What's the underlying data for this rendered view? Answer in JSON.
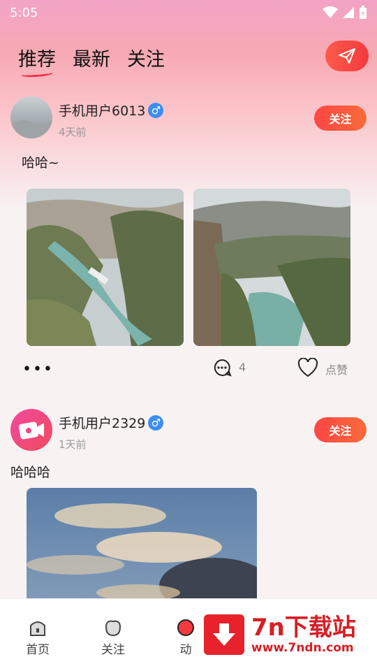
{
  "status_bar": {
    "time": "5:05"
  },
  "header": {
    "tabs": [
      {
        "label": "推荐",
        "active": true
      },
      {
        "label": "最新",
        "active": false
      },
      {
        "label": "关注",
        "active": false
      }
    ]
  },
  "posts": [
    {
      "username": "手机用户6013",
      "gender_symbol": "♂",
      "time": "4天前",
      "follow_label": "关注",
      "text": "哈哈~",
      "comment_count": "4",
      "like_label": "点赞",
      "more_label": "•••"
    },
    {
      "username": "手机用户2329",
      "gender_symbol": "♂",
      "time": "1天前",
      "follow_label": "关注",
      "text": "哈哈哈"
    }
  ],
  "bottom_nav": {
    "items": [
      {
        "label": "首页"
      },
      {
        "label": "关注"
      },
      {
        "label": "动"
      }
    ]
  },
  "watermark": {
    "title": "7n下载站",
    "url": "www.7ndn.com"
  },
  "colors": {
    "accent": "#f43a3f",
    "follow_gradient_start": "#ff4545",
    "gender_blue": "#3d8ef0"
  }
}
